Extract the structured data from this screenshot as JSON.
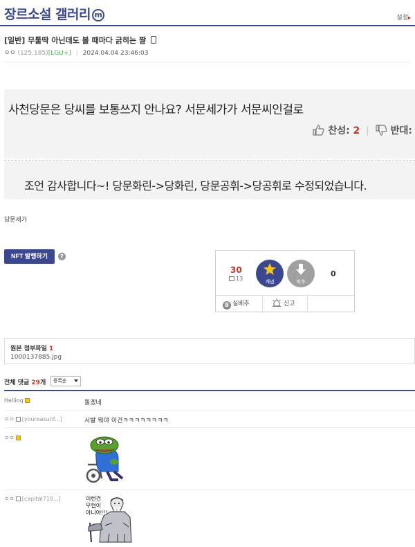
{
  "header": {
    "gallery_title": "장르소설 갤러리",
    "badge": "ⓜ",
    "settings_label": "설정"
  },
  "post": {
    "category": "[일반]",
    "title": "무툴딱 아닌데도 볼 때마다 긁히는 짤",
    "writer": "ㅇㅇ",
    "ip": "(125.185)",
    "carrier": "[LGU+]",
    "date": "2024.04.04 23:46:03",
    "question": "사천당문은 당씨를 보통쓰지 안나요? 서문세가가 서문씨인걸로",
    "vote_up_label": "찬성:",
    "vote_up_count": "2",
    "vote_down_label": "반대:",
    "vote_down_count": "0",
    "answer": "조언 감사합니다~! 당문화린->당화린, 당문공휘->당공휘로 수정되었습니다.",
    "body_text": "당문세가"
  },
  "nft": {
    "button_label": "NFT 발행하기",
    "help": "?"
  },
  "recommend": {
    "count": "30",
    "fixed_count": "13",
    "up_label": "개념",
    "down_label": "비추",
    "down_count": "0",
    "silbechu_label": "실베추",
    "silbechu_icon": "B",
    "report_label": "신고"
  },
  "attachment": {
    "label": "원본 첨부파일",
    "count": "1",
    "filename": "1000137885.jpg"
  },
  "comments": {
    "header_label": "전체 댓글",
    "count": "29",
    "suffix": "개",
    "sort_label": "등록순",
    "items": [
      {
        "writer": "Hellinq",
        "text": "돌겠네"
      },
      {
        "writer": "ㅇㅇ",
        "id": "[youreasunf...]",
        "text": "시발 뭐야 이건ㅋㅋㅋㅋㅋㅋㅋㅋ"
      },
      {
        "writer": "ㅇㅇ",
        "text": ""
      },
      {
        "writer": "ㅇㅇ",
        "id": "[capital710...]",
        "text": ""
      }
    ],
    "dccon_text": [
      "이런건",
      "무협이",
      "아니야!!!"
    ]
  },
  "colors": {
    "primary": "#3b4890",
    "accent_red": "#c0392b",
    "carrier_green": "#4caf50"
  }
}
